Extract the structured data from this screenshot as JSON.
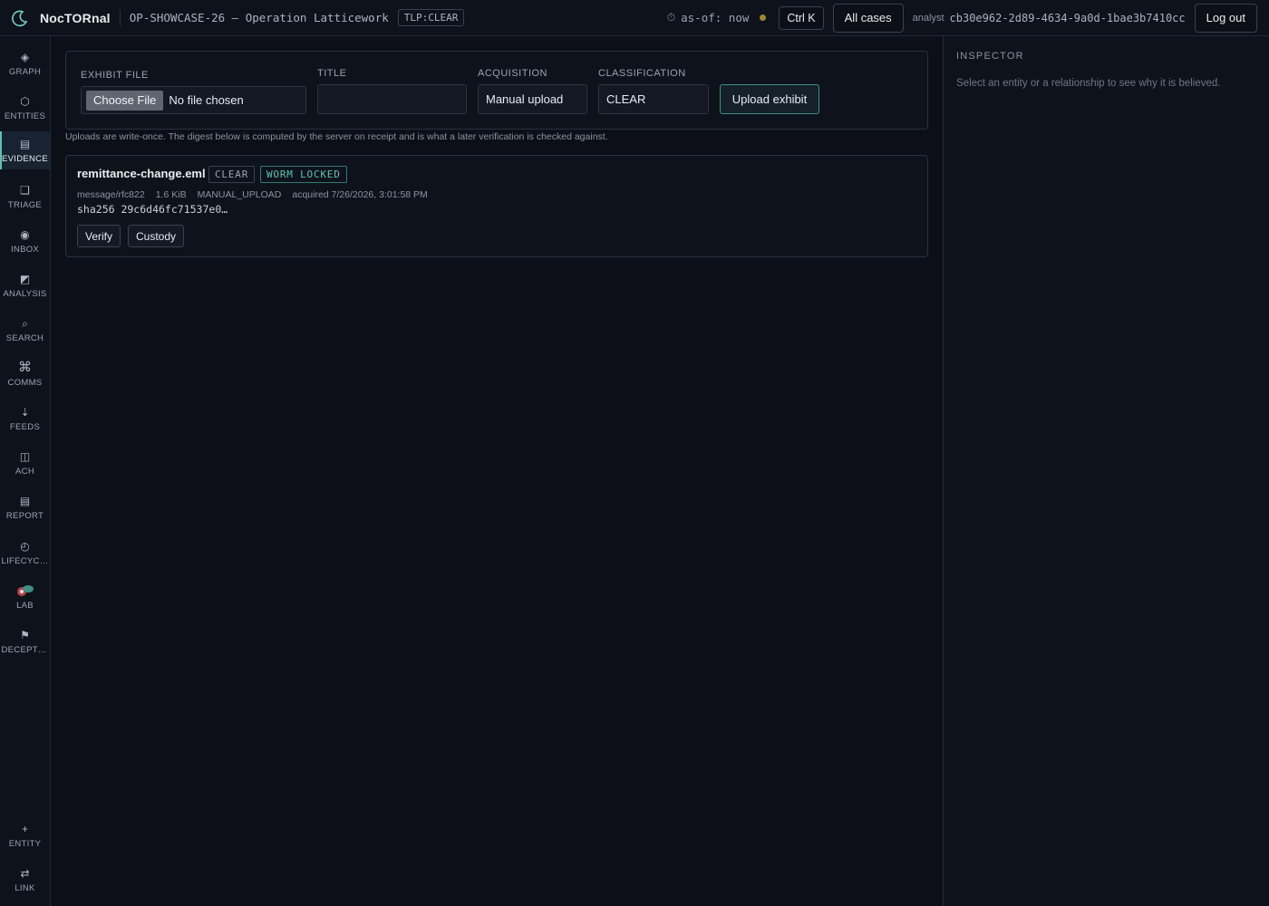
{
  "header": {
    "brand": "NocTORnal",
    "case_title": "OP-SHOWCASE-26 — Operation Latticework",
    "tlp": "TLP:CLEAR",
    "as_of": "as-of: now",
    "shortcut": "Ctrl K",
    "all_cases": "All cases",
    "analyst_label": "analyst",
    "analyst_id": "cb30e962-2d89-4634-9a0d-1bae3b7410cc",
    "logout": "Log out"
  },
  "sidebar": {
    "items": [
      {
        "label": "GRAPH",
        "icon": "graph-icon"
      },
      {
        "label": "ENTITIES",
        "icon": "hexagon-icon"
      },
      {
        "label": "EVIDENCE",
        "icon": "evidence-icon",
        "active": true
      },
      {
        "label": "TRIAGE",
        "icon": "square-icon"
      },
      {
        "label": "INBOX",
        "icon": "inbox-icon"
      },
      {
        "label": "ANALYSIS",
        "icon": "analysis-icon"
      },
      {
        "label": "SEARCH",
        "icon": "search-icon"
      },
      {
        "label": "COMMS",
        "icon": "command-icon"
      },
      {
        "label": "FEEDS",
        "icon": "feeds-icon"
      },
      {
        "label": "ACH",
        "icon": "columns-icon"
      },
      {
        "label": "REPORT",
        "icon": "report-icon"
      },
      {
        "label": "LIFECYCLE",
        "icon": "clock-icon"
      },
      {
        "label": "LAB",
        "icon": "lab-icon"
      },
      {
        "label": "DECEPTI…",
        "icon": "flag-icon"
      }
    ],
    "bottom": [
      {
        "label": "ENTITY",
        "icon": "plus-icon"
      },
      {
        "label": "LINK",
        "icon": "swap-icon"
      }
    ]
  },
  "upload": {
    "exhibit_file_label": "EXHIBIT FILE",
    "choose_file": "Choose File",
    "no_file": "No file chosen",
    "title_label": "TITLE",
    "title_value": "",
    "acquisition_label": "ACQUISITION",
    "acquisition_value": "Manual upload",
    "classification_label": "CLASSIFICATION",
    "classification_value": "CLEAR",
    "upload_button": "Upload exhibit",
    "note": "Uploads are write-once. The digest below is computed by the server on receipt and is what a later verification is checked against."
  },
  "exhibit": {
    "name": "remittance-change.eml",
    "classification": "CLEAR",
    "lock": "WORM LOCKED",
    "mime": "message/rfc822",
    "size": "1.6 KiB",
    "acquisition": "MANUAL_UPLOAD",
    "acquired": "acquired 7/26/2026, 3:01:58 PM",
    "hash": "sha256 29c6d46fc71537e0…",
    "verify": "Verify",
    "custody": "Custody"
  },
  "inspector": {
    "title": "INSPECTOR",
    "hint": "Select an entity or a relationship to see why it is believed."
  },
  "colors": {
    "accent": "#5ec3b2",
    "background": "#0c0f17",
    "panel": "#0e121b",
    "status_dot": "#9a8a2e"
  }
}
